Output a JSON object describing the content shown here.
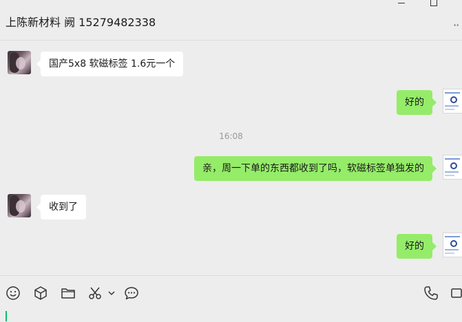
{
  "window": {
    "min_icon": "minimize-icon",
    "max_icon": "maximize-icon"
  },
  "header": {
    "title": "上陈新材料 阙 15279482338",
    "more_icon": "more-icon",
    "more_glyph": "··"
  },
  "messages": [
    {
      "side": "in",
      "text": "国产5x8 软磁标签   1.6元一个"
    },
    {
      "side": "out",
      "text": "好的"
    },
    {
      "side": "time",
      "text": "16:08"
    },
    {
      "side": "out",
      "text": "亲，周一下单的东西都收到了吗，软磁标签单独发的"
    },
    {
      "side": "in",
      "text": "收到了"
    },
    {
      "side": "out",
      "text": "好的"
    }
  ],
  "toolbar": {
    "icons": [
      "emoji-icon",
      "sticker-icon",
      "folder-icon",
      "scissors-icon",
      "chevron-down-icon",
      "chat-history-icon",
      "phone-icon",
      "video-call-icon"
    ]
  },
  "input": {
    "value": ""
  },
  "colors": {
    "background": "#ededed",
    "incoming_bubble": "#ffffff",
    "outgoing_bubble": "#95ec69",
    "cursor": "#07c160"
  }
}
